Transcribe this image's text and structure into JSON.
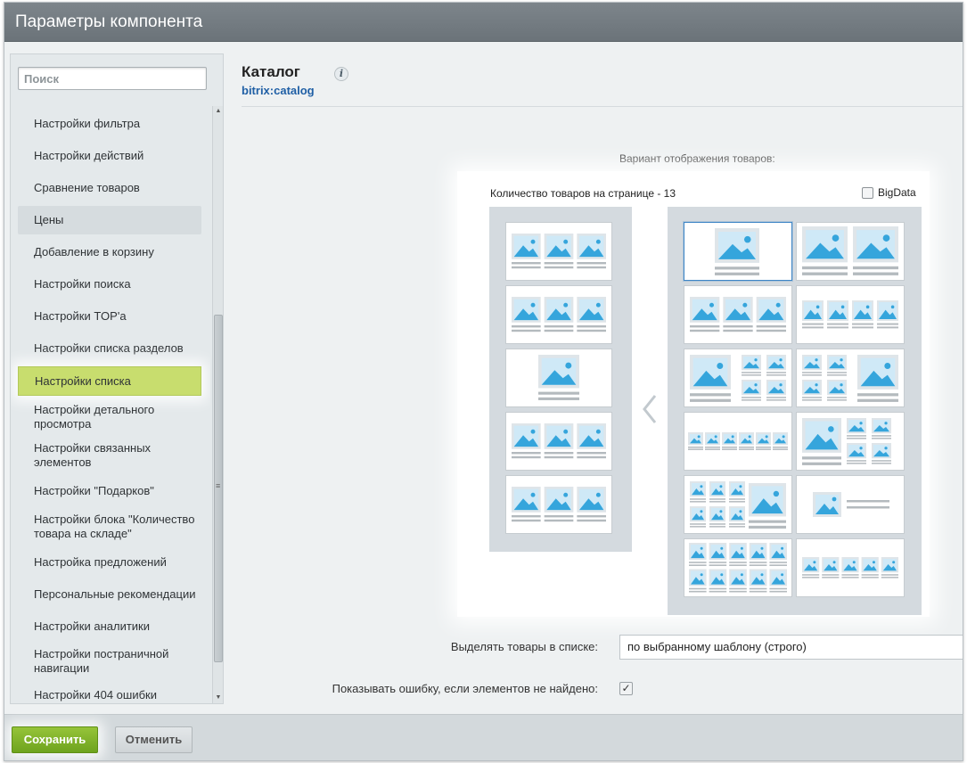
{
  "window": {
    "title": "Параметры компонента"
  },
  "sidebar": {
    "search_placeholder": "Поиск",
    "items": [
      {
        "label": "Настройки фильтра"
      },
      {
        "label": "Настройки действий"
      },
      {
        "label": "Сравнение товаров"
      },
      {
        "label": "Цены"
      },
      {
        "label": "Добавление в корзину"
      },
      {
        "label": "Настройки поиска"
      },
      {
        "label": "Настройки TOP'а"
      },
      {
        "label": "Настройки списка разделов"
      },
      {
        "label": "Настройки списка"
      },
      {
        "label": "Настройки детального просмотра"
      },
      {
        "label": "Настройки связанных элементов"
      },
      {
        "label": "Настройки \"Подарков\""
      },
      {
        "label": "Настройки блока \"Количество товара на складе\""
      },
      {
        "label": "Настройка предложений"
      },
      {
        "label": "Персональные рекомендации"
      },
      {
        "label": "Настройки аналитики"
      },
      {
        "label": "Настройки постраничной навигации"
      },
      {
        "label": "Настройки 404 ошибки"
      }
    ],
    "active_item": "Настройки списка",
    "hover_item": "Цены"
  },
  "component": {
    "title": "Каталог",
    "code": "bitrix:catalog",
    "info_icon": "info-icon"
  },
  "view_variant": {
    "label": "Вариант отображения товаров:",
    "count_label": "Количество товаров на странице - 13",
    "bigdata_label": "BigData",
    "bigdata_checked": false
  },
  "fields": {
    "highlight_label": "Выделять товары в списке:",
    "highlight_value": "по выбранному шаблону (строго)",
    "show_error_label": "Показывать ошибку, если элементов не найдено:",
    "show_error_checked": true
  },
  "footer": {
    "save_label": "Сохранить",
    "cancel_label": "Отменить"
  },
  "colors": {
    "accent_green": "#c8dd6e",
    "save_button": "#7fb22a",
    "link_blue": "#1f5fa5",
    "image_blue": "#35a5dc"
  }
}
